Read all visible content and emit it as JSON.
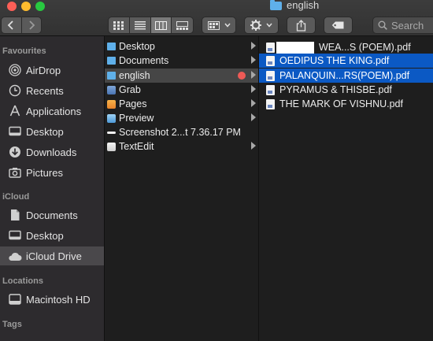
{
  "window": {
    "title": "english"
  },
  "toolbar": {
    "back_icon": "chevron-left-icon",
    "forward_icon": "chevron-right-icon",
    "view_modes": [
      "icon-view-icon",
      "list-view-icon",
      "column-view-icon",
      "gallery-view-icon"
    ],
    "group_icon": "group-by-icon",
    "action_icon": "gear-icon",
    "share_icon": "share-icon",
    "tag_icon": "tag-icon",
    "search_placeholder": "Search"
  },
  "sidebar": {
    "favourites_label": "Favourites",
    "favourites": [
      {
        "label": "AirDrop",
        "icon": "airdrop-icon"
      },
      {
        "label": "Recents",
        "icon": "clock-icon"
      },
      {
        "label": "Applications",
        "icon": "applications-icon"
      },
      {
        "label": "Desktop",
        "icon": "desktop-icon"
      },
      {
        "label": "Downloads",
        "icon": "download-icon"
      },
      {
        "label": "Pictures",
        "icon": "camera-icon"
      }
    ],
    "icloud_label": "iCloud",
    "icloud": [
      {
        "label": "Documents",
        "icon": "document-icon"
      },
      {
        "label": "Desktop",
        "icon": "desktop-icon"
      },
      {
        "label": "iCloud Drive",
        "icon": "cloud-icon"
      }
    ],
    "locations_label": "Locations",
    "locations": [
      {
        "label": "Macintosh HD",
        "icon": "hard-drive-icon"
      }
    ],
    "tags_label": "Tags"
  },
  "column1": [
    {
      "name": "Desktop",
      "kind": "folder",
      "has_children": true
    },
    {
      "name": "Documents",
      "kind": "folder",
      "has_children": true
    },
    {
      "name": "english",
      "kind": "folder",
      "has_children": true,
      "selected": true,
      "tag_color": "#ee5a56"
    },
    {
      "name": "Grab",
      "kind": "app",
      "has_children": true
    },
    {
      "name": "Pages",
      "kind": "app",
      "has_children": true
    },
    {
      "name": "Preview",
      "kind": "app",
      "has_children": true
    },
    {
      "name": "Screenshot 2...t 7.36.17 PM",
      "kind": "image",
      "has_children": false
    },
    {
      "name": "TextEdit",
      "kind": "app",
      "has_children": true
    }
  ],
  "column2": [
    {
      "name": "WEA...S (POEM).pdf",
      "redacted_prefix": true,
      "selected": false
    },
    {
      "name": "OEDIPUS THE KING.pdf",
      "selected": true
    },
    {
      "name": "PALANQUIN...RS(POEM).pdf",
      "selected": true
    },
    {
      "name": "PYRAMUS & THISBE.pdf",
      "selected": false
    },
    {
      "name": "THE MARK OF VISHNU.pdf",
      "selected": false
    }
  ],
  "colors": {
    "selection_blue": "#0b59c4",
    "folder_blue": "#5fb0ea",
    "red_tag": "#ee5a56"
  }
}
